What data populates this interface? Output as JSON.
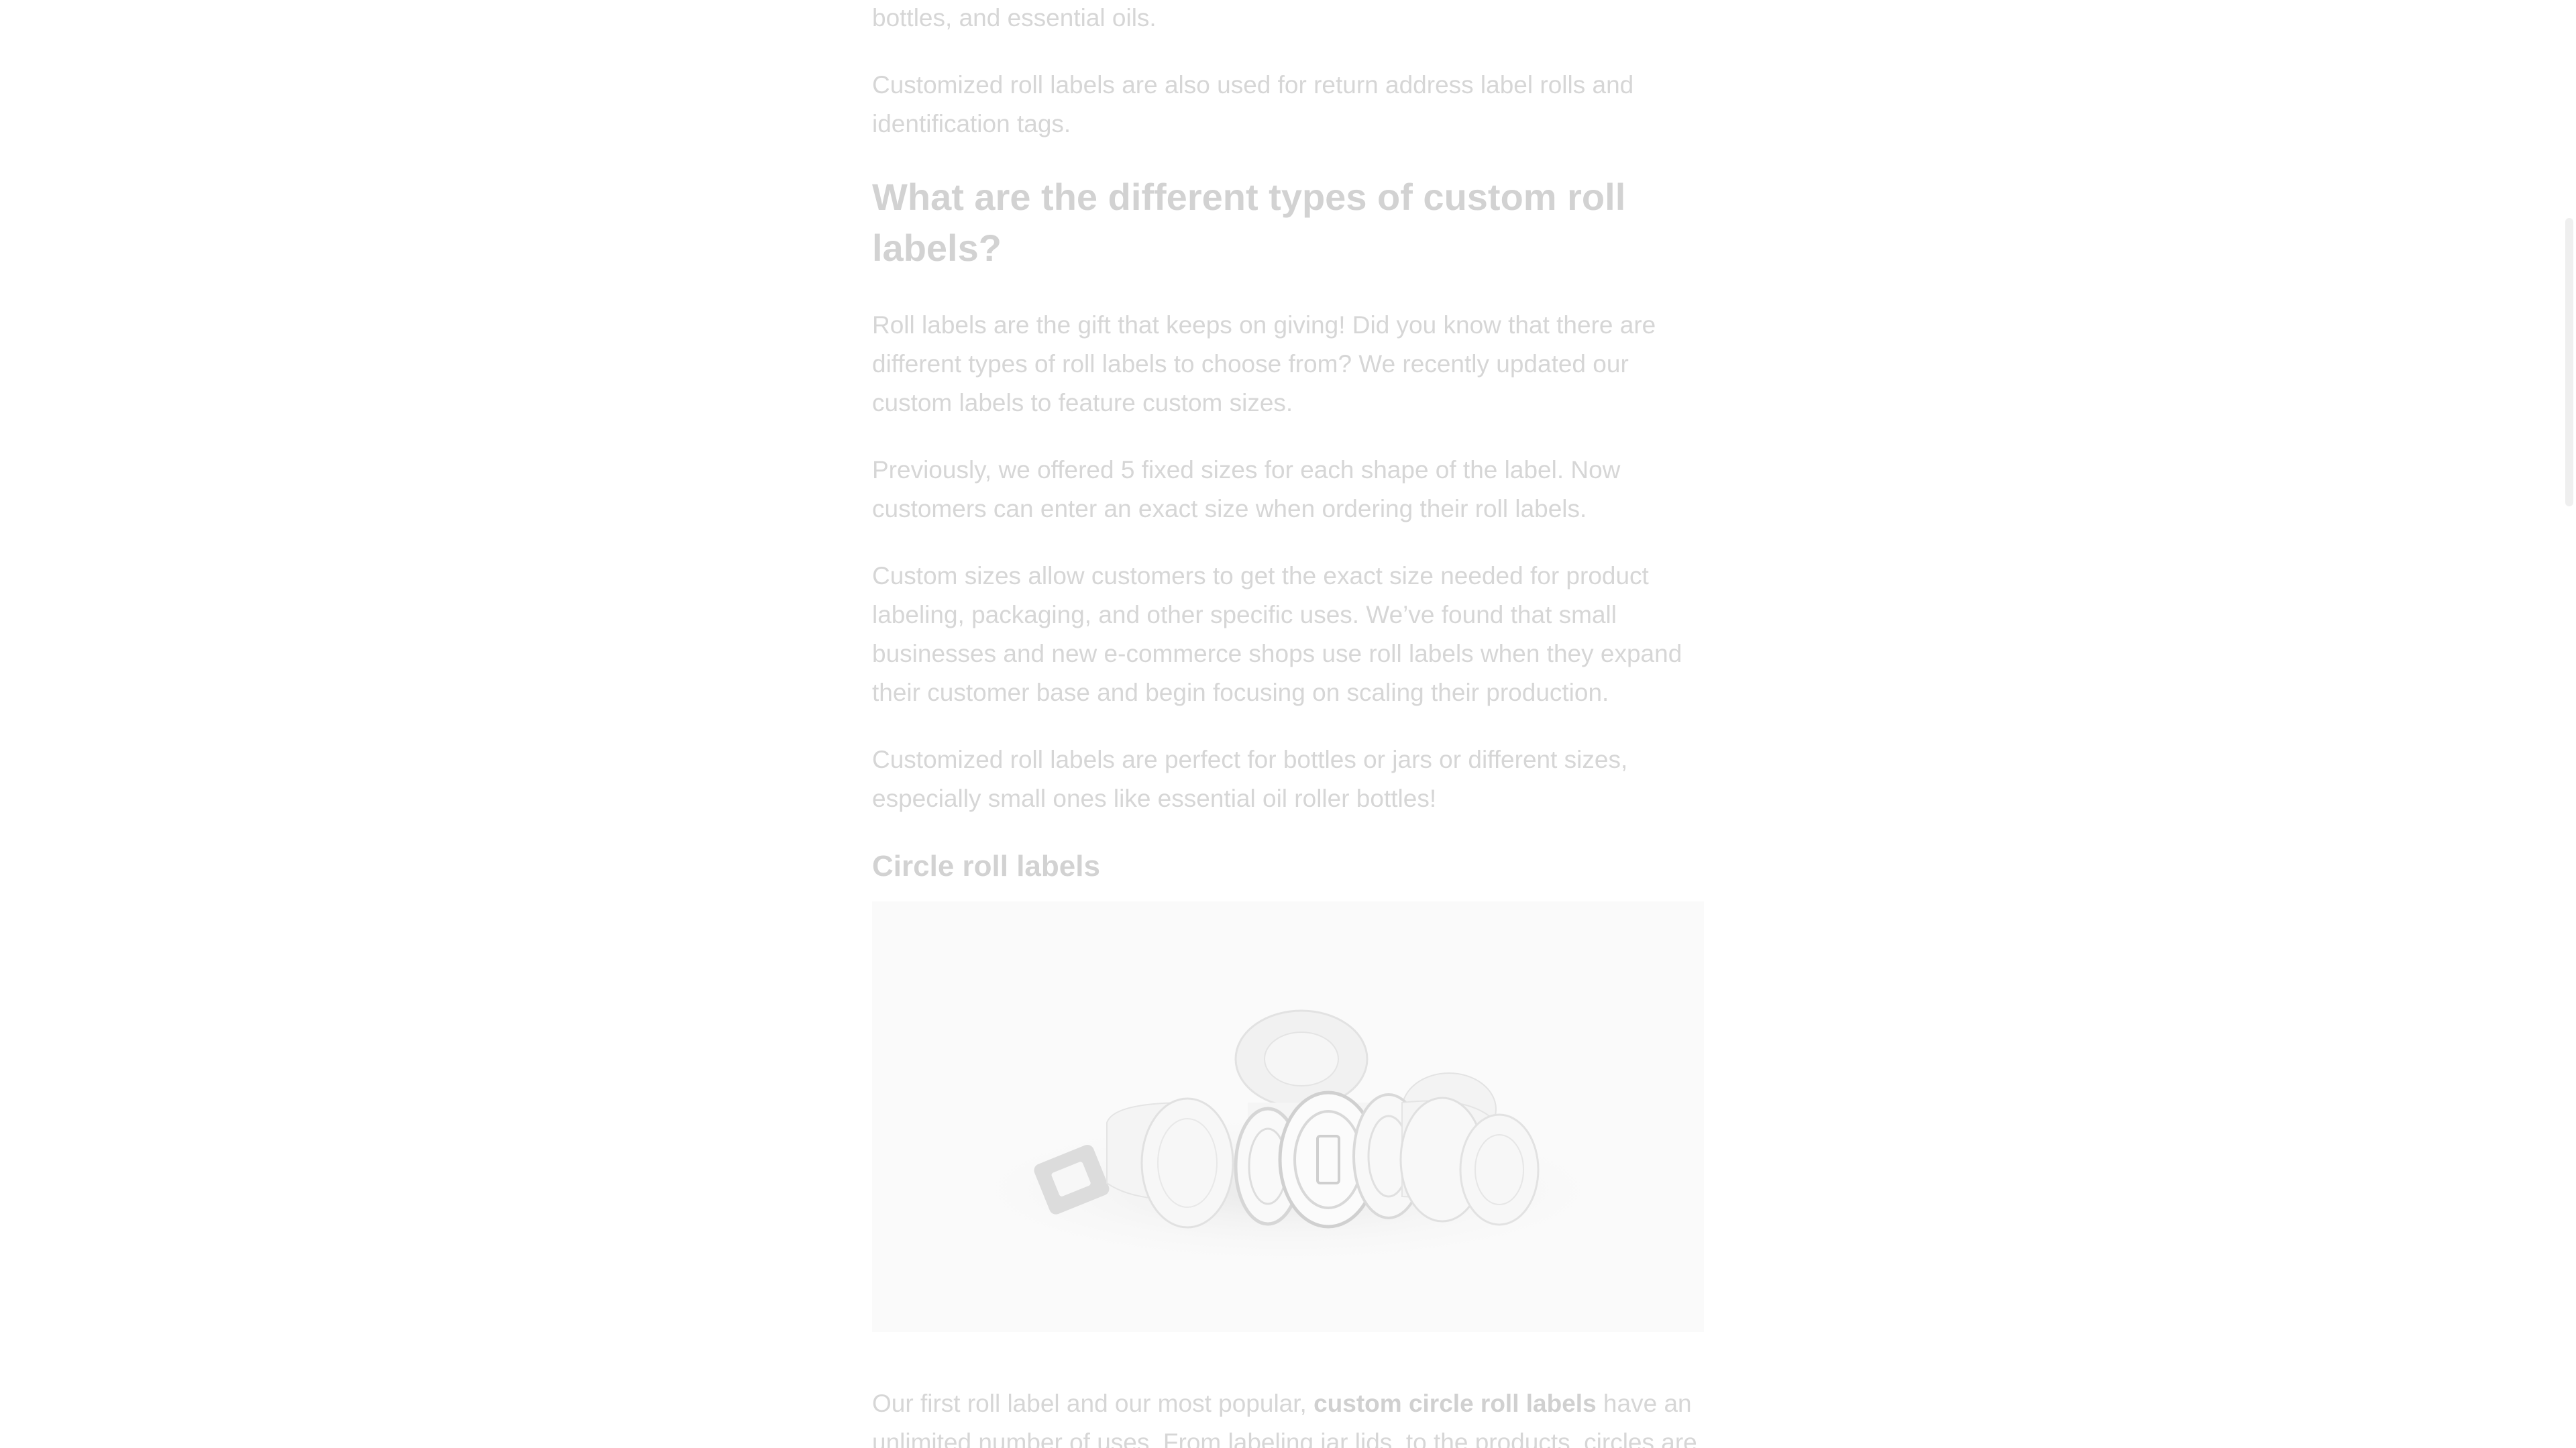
{
  "article": {
    "para_intro_tail": "use it in your home to label your mason jars, refillable shampoo or soap bottles, and essential oils.",
    "para_return_address": "Customized roll labels are also used for return address label rolls and identification tags.",
    "heading_types": "What are the different types of custom roll labels?",
    "para_gift": "Roll labels are the gift that keeps on giving! Did you know that there are different types of roll labels to choose from? We recently updated our custom labels to feature custom sizes.",
    "para_previously": "Previously, we offered 5 fixed sizes for each shape of the label. Now customers can enter an exact size when ordering their roll labels.",
    "para_custom_sizes": "Custom sizes allow customers to get the exact size needed for product labeling, packaging, and other specific uses. We’ve found that small businesses and new e-commerce shops use roll labels when they expand their customer base and begin focusing on scaling their production.",
    "para_perfect": "Customized roll labels are perfect for bottles or jars or different sizes, especially small ones like essential oil roller bottles!",
    "subheading_circle": "Circle roll labels",
    "para_first_before": "Our first roll label and our most popular, ",
    "para_first_bold": "custom circle roll labels",
    "para_first_after": " have an unlimited number of uses. From labeling jar lids, to the products, circles are"
  },
  "colors": {
    "text": "#d6d6d6",
    "heading": "#d2d2d2",
    "image_bg": "#fafafa",
    "scrollbar_thumb": "#efefef"
  }
}
